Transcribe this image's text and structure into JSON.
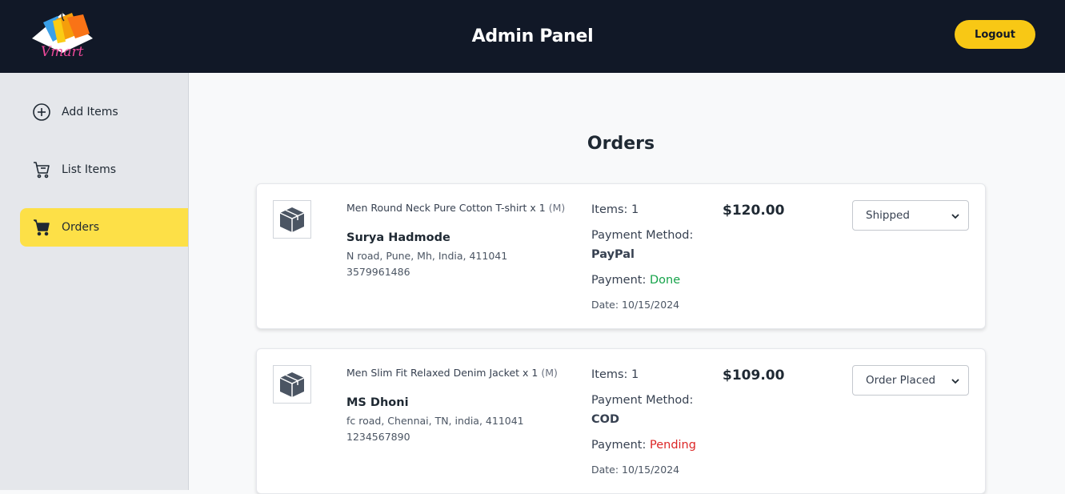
{
  "header": {
    "logo_text": "Vmart",
    "title": "Admin Panel",
    "logout_label": "Logout"
  },
  "sidebar": {
    "items": [
      {
        "label": "Add Items",
        "icon": "plus-circle-icon",
        "active": false
      },
      {
        "label": "List Items",
        "icon": "cart-icon",
        "active": false
      },
      {
        "label": "Orders",
        "icon": "cart-filled-icon",
        "active": true
      }
    ]
  },
  "main": {
    "title": "Orders",
    "orders": [
      {
        "product": "Men Round Neck Pure Cotton T-shirt x 1",
        "size": "(M)",
        "customer": "Surya Hadmode",
        "address": "N road, Pune, Mh, India, 411041",
        "phone": "3579961486",
        "items": "Items: 1",
        "payment_method_label": "Payment Method:",
        "payment_method": "PayPal",
        "payment_label": "Payment:",
        "payment_status": "Done",
        "date": "Date: 10/15/2024",
        "amount": "$120.00",
        "status": "Shipped"
      },
      {
        "product": "Men Slim Fit Relaxed Denim Jacket x 1",
        "size": "(M)",
        "customer": "MS Dhoni",
        "address": "fc road, Chennai, TN, india, 411041",
        "phone": "1234567890",
        "items": "Items: 1",
        "payment_method_label": "Payment Method:",
        "payment_method": "COD",
        "payment_label": "Payment:",
        "payment_status": "Pending",
        "date": "Date: 10/15/2024",
        "amount": "$109.00",
        "status": "Order Placed"
      }
    ]
  },
  "colors": {
    "header_bg": "#111827",
    "accent": "#f8c815",
    "active_nav": "#fde047",
    "payment_done": "#16a34a",
    "payment_pending": "#dc2626"
  }
}
